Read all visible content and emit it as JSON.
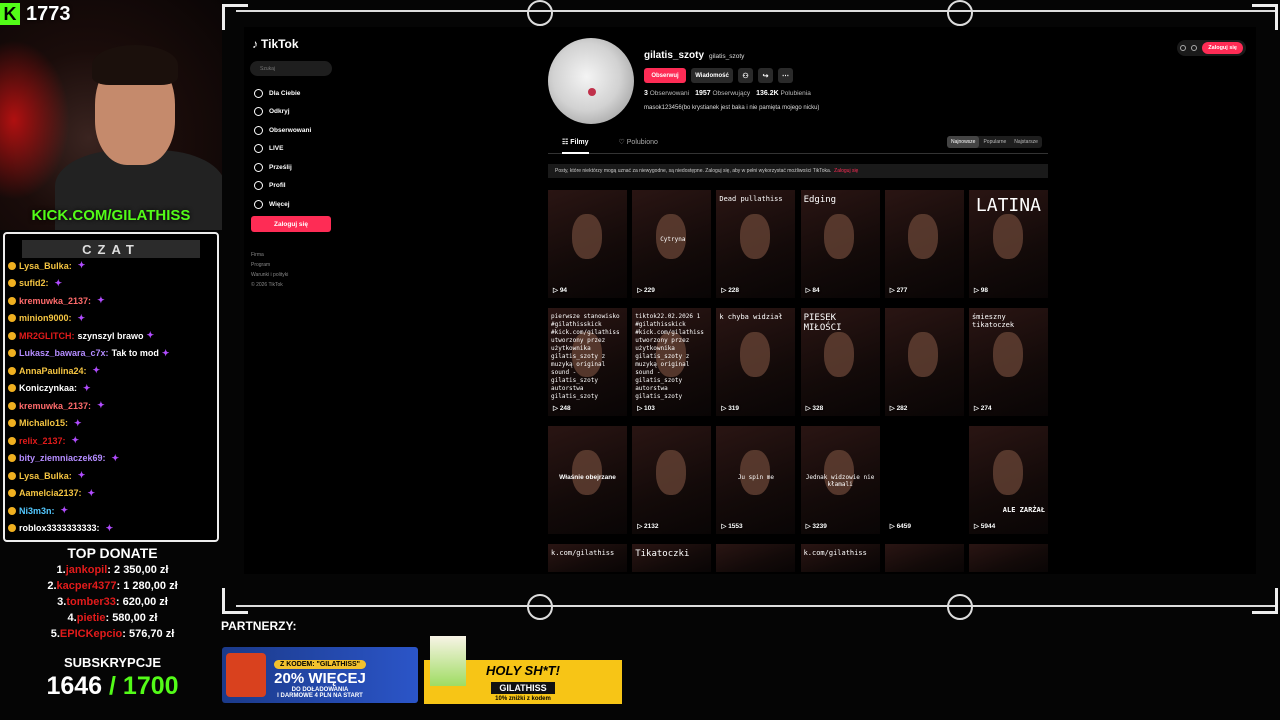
{
  "kick": {
    "viewers": "1773",
    "url": "KICK.COM/GILATHISS"
  },
  "chat": {
    "title": "CZAT",
    "messages": [
      {
        "user": "Lysa_Bulka:",
        "text": "",
        "color": "#f5c542"
      },
      {
        "user": "sufid2:",
        "text": "",
        "color": "#f5c542"
      },
      {
        "user": "kremuwka_2137:",
        "text": "",
        "color": "#ff6b6b"
      },
      {
        "user": "minion9000:",
        "text": "",
        "color": "#f5c542"
      },
      {
        "user": "MR2GLITCH:",
        "text": "szynszyl brawo",
        "color": "#e21b1b"
      },
      {
        "user": "Lukasz_bawara_c7x:",
        "text": "Tak to mod",
        "color": "#b48cff"
      },
      {
        "user": "AnnaPaulina24:",
        "text": "",
        "color": "#f5c542"
      },
      {
        "user": "Koniczynkaa:",
        "text": "",
        "color": "#ffffff"
      },
      {
        "user": "kremuwka_2137:",
        "text": "",
        "color": "#ff6b6b"
      },
      {
        "user": "Michallo15:",
        "text": "",
        "color": "#f5c542"
      },
      {
        "user": "relix_2137:",
        "text": "",
        "color": "#e21b1b"
      },
      {
        "user": "bity_ziemniaczek69:",
        "text": "",
        "color": "#b48cff"
      },
      {
        "user": "Lysa_Bulka:",
        "text": "",
        "color": "#f5c542"
      },
      {
        "user": "Aamelcia2137:",
        "text": "",
        "color": "#f5c542"
      },
      {
        "user": "Ni3m3n:",
        "text": "",
        "color": "#53c8ff"
      },
      {
        "user": "roblox3333333333:",
        "text": "",
        "color": "#ffffff"
      }
    ]
  },
  "top_donate": {
    "title": "TOP DONATE",
    "entries": [
      {
        "rank": "1.",
        "name": "jankopil",
        "amount": ": 2 350,00 zł"
      },
      {
        "rank": "2.",
        "name": "kacper4377",
        "amount": ": 1 280,00 zł"
      },
      {
        "rank": "3.",
        "name": "tomber33",
        "amount": ": 620,00 zł"
      },
      {
        "rank": "4.",
        "name": "pietie",
        "amount": ": 580,00 zł"
      },
      {
        "rank": "5.",
        "name": "EPICKepcio",
        "amount": ": 576,70 zł"
      }
    ]
  },
  "subs": {
    "label": "SUBSKRYPCJE",
    "count": "1646",
    "goal": "/ 1700"
  },
  "tiktok": {
    "logo": "TikTok",
    "search_placeholder": "Szukaj",
    "nav": [
      "Dla Ciebie",
      "Odkryj",
      "Obserwowani",
      "LIVE",
      "Prześlij",
      "Profil",
      "Więcej"
    ],
    "login_button": "Zaloguj się",
    "footer": [
      "Firma",
      "Program",
      "Warunki i polityki",
      "© 2026 TikTok"
    ],
    "top_login": "Zaloguj się"
  },
  "profile": {
    "username": "gilatis_szoty",
    "nickname": "gilatis_szoty",
    "follow_label": "Obserwuj",
    "message_label": "Wiadomość",
    "stats": [
      {
        "value": "3",
        "label": "Obserwowani"
      },
      {
        "value": "1957",
        "label": "Obserwujący"
      },
      {
        "value": "136.2K",
        "label": "Polubienia"
      }
    ],
    "bio": "masok123456(bo krystianek jest baka i nie pamięta mojego nicku)",
    "tabs": [
      "Filmy",
      "Polubiono"
    ],
    "sort": [
      "Najnowsze",
      "Popularne",
      "Najstarsze"
    ],
    "banner": "Posty, które niektórzy mogą uznać za niewygodne, są niedostępne. Zaloguj się, aby w pełni wykorzystać możliwości TikToka.",
    "banner_link": "Zaloguj się"
  },
  "videos": [
    {
      "views": "94",
      "caption": ""
    },
    {
      "views": "229",
      "caption": "Cytryna"
    },
    {
      "views": "228",
      "caption": "Dead pullathiss"
    },
    {
      "views": "84",
      "caption": "Edging"
    },
    {
      "views": "277",
      "caption": ""
    },
    {
      "views": "98",
      "caption": "LATINA"
    },
    {
      "views": "248",
      "caption": "pierwsze stanowisko #gilathisskick #kick.com/gilathiss utworzony przez użytkownika gilatis_szoty z muzyką original sound - gilatis_szoty autorstwa gilatis_szoty"
    },
    {
      "views": "103",
      "caption": "tiktok22.02.2026 1 #gilathisskick #kick.com/gilathiss utworzony przez użytkownika gilatis_szoty z muzyką original sound - gilatis_szoty autorstwa gilatis_szoty"
    },
    {
      "views": "319",
      "caption": "k chyba widział"
    },
    {
      "views": "328",
      "caption": "PIESEK MIŁOŚCI"
    },
    {
      "views": "282",
      "caption": ""
    },
    {
      "views": "274",
      "caption": "śmieszny tikatoczek"
    },
    {
      "views": "",
      "caption": "Właśnie obejrzane"
    },
    {
      "views": "2132",
      "caption": ""
    },
    {
      "views": "1553",
      "caption": "Ju spin me"
    },
    {
      "views": "3239",
      "caption": "Jednak widzowie nie kłamali"
    },
    {
      "views": "6459",
      "caption": ""
    },
    {
      "views": "5944",
      "caption": "ALE ZARŻAŁ"
    },
    {
      "views": "",
      "caption": "k.com/gilathiss"
    },
    {
      "views": "",
      "caption": "Tikatoczki"
    },
    {
      "views": "",
      "caption": ""
    },
    {
      "views": "",
      "caption": "k.com/gilathiss"
    },
    {
      "views": "",
      "caption": ""
    },
    {
      "views": "",
      "caption": ""
    }
  ],
  "partners": {
    "label": "PARTNERZY:",
    "promo1": {
      "code": "Z KODEM: \"GILATHISS\"",
      "percent": "20% WIĘCEJ",
      "line1": "DO DOŁADOWANIA",
      "line2": "I DARMOWE 4 PLN NA START"
    },
    "promo2": {
      "title": "HOLY SH*T!",
      "code": "GILATHISS",
      "sub": "10% zniżki z kodem"
    }
  }
}
